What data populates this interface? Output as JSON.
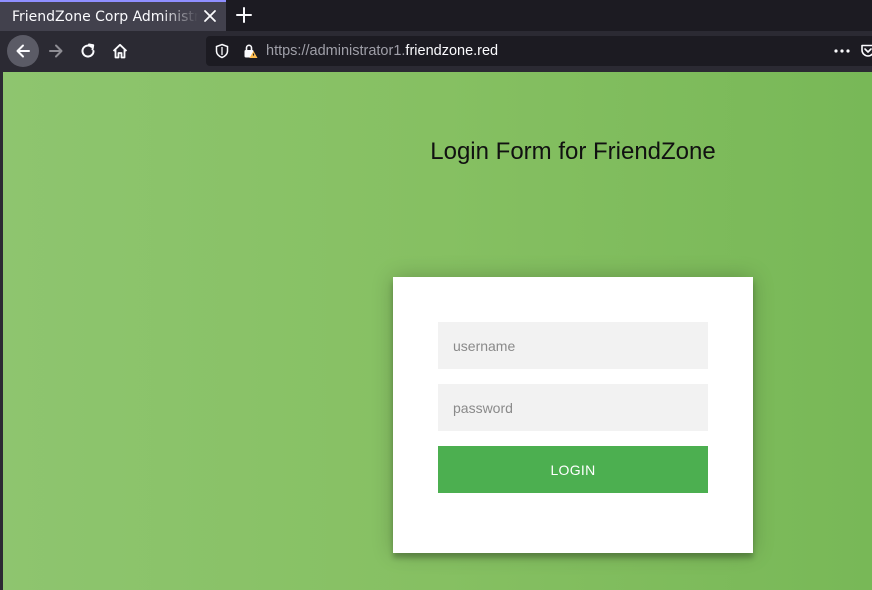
{
  "browser": {
    "tab_title": "FriendZone Corp Administrator Page",
    "url_prefix": "https://administrator1.",
    "url_host": "friendzone.red"
  },
  "page": {
    "heading": "Login Form for FriendZone",
    "username_placeholder": "username",
    "password_placeholder": "password",
    "login_label": "LOGIN"
  },
  "colors": {
    "background_green": "#86c062",
    "button_green": "#4caf50",
    "field_gray": "#f2f2f2"
  },
  "icons": [
    "back-arrow-icon",
    "forward-arrow-icon",
    "reload-icon",
    "home-icon",
    "shield-icon",
    "insecure-lock-icon",
    "more-dots-icon",
    "pocket-icon",
    "close-icon",
    "plus-icon"
  ]
}
